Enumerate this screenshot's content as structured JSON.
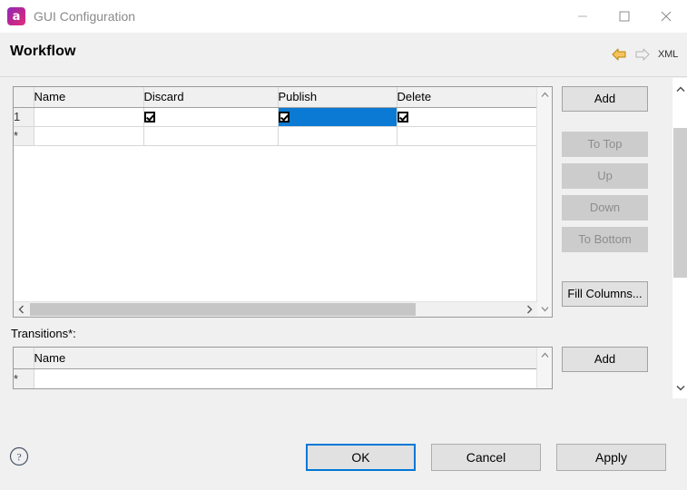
{
  "window": {
    "title": "GUI Configuration",
    "icon": "app-icon",
    "icon_glyph": "a",
    "controls": {
      "minimize": "minimize-icon",
      "maximize": "maximize-icon",
      "close": "close-icon"
    }
  },
  "header": {
    "title": "Workflow",
    "tools": {
      "back": "back-arrow-icon",
      "forward": "forward-arrow-icon",
      "xml_label": "XML"
    }
  },
  "workflow_table": {
    "row_header_blank": "",
    "columns": [
      "Name",
      "Discard",
      "Publish",
      "Delete"
    ],
    "rows": [
      {
        "header": "1",
        "cells": [
          {
            "type": "text",
            "value": "",
            "selected": false
          },
          {
            "type": "checkbox",
            "checked": true,
            "selected": false
          },
          {
            "type": "checkbox",
            "checked": true,
            "selected": true
          },
          {
            "type": "checkbox",
            "checked": true,
            "selected": false
          }
        ]
      },
      {
        "header": "*",
        "cells": [
          {
            "type": "text",
            "value": "",
            "selected": false
          },
          {
            "type": "text",
            "value": "",
            "selected": false
          },
          {
            "type": "text",
            "value": "",
            "selected": false
          },
          {
            "type": "text",
            "value": "",
            "selected": false
          }
        ]
      }
    ],
    "scrollbar": {
      "up": "chevron-up-icon",
      "down": "chevron-down-icon",
      "left": "chevron-left-icon",
      "right": "chevron-right-icon"
    }
  },
  "workflow_buttons": [
    {
      "label": "Add",
      "enabled": true
    },
    {
      "label": "To Top",
      "enabled": false
    },
    {
      "label": "Up",
      "enabled": false
    },
    {
      "label": "Down",
      "enabled": false
    },
    {
      "label": "To Bottom",
      "enabled": false
    },
    {
      "label": "Fill Columns...",
      "enabled": true
    }
  ],
  "transitions": {
    "label": "Transitions*:",
    "columns": [
      "Name"
    ],
    "rows": [
      {
        "header": "*",
        "cells": [
          {
            "type": "text",
            "value": ""
          }
        ]
      }
    ],
    "add_label": "Add"
  },
  "footer": {
    "help": "help-icon",
    "ok": "OK",
    "cancel": "Cancel",
    "apply": "Apply"
  },
  "colors": {
    "selection_blue": "#0b7ad4",
    "default_button_focus": "#0078d7",
    "back_arrow": "#e3a21a",
    "dialog_bg": "#f0f0f0"
  }
}
